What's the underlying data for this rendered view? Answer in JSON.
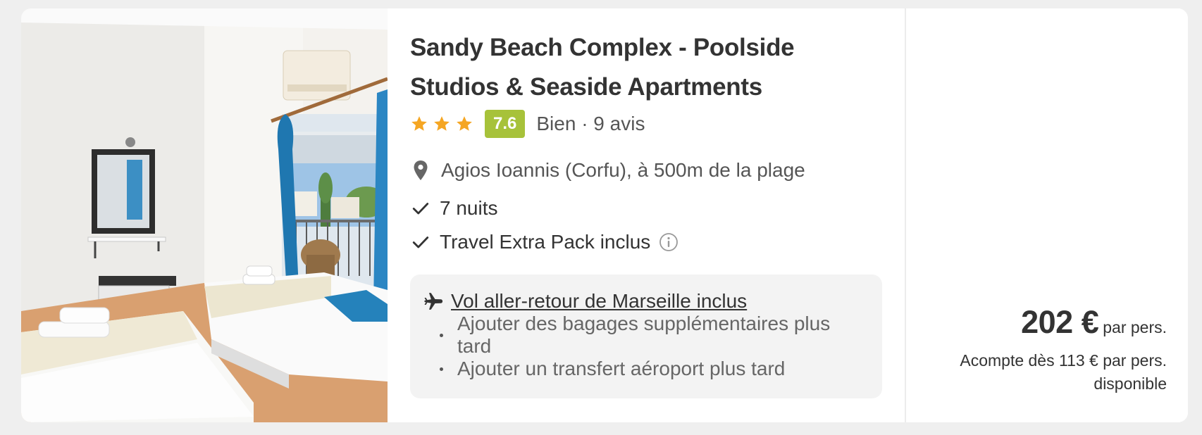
{
  "hotel": {
    "name": "Sandy Beach Complex - Poolside Studios & Seaside Apartments",
    "star_count": 3,
    "score": "7.6",
    "rating_label": "Bien · 9 avis",
    "location": "Agios Ioannis (Corfu), à 500m de la plage"
  },
  "features": [
    {
      "label": "7 nuits"
    },
    {
      "label": "Travel Extra Pack inclus"
    }
  ],
  "flight": {
    "link_label": "Vol aller-retour de Marseille inclus",
    "options": [
      "Ajouter des bagages supplémentaires plus tard",
      "Ajouter un transfert aéroport plus tard"
    ]
  },
  "price": {
    "amount": "202 €",
    "unit": "par pers.",
    "deposit": "Acompte dès 113 € par pers. disponible"
  },
  "colors": {
    "star": "#f5a623",
    "score_badge": "#a7c23a",
    "card_bg": "#ffffff",
    "page_bg": "#efefef",
    "flight_box_bg": "#f3f3f3"
  }
}
